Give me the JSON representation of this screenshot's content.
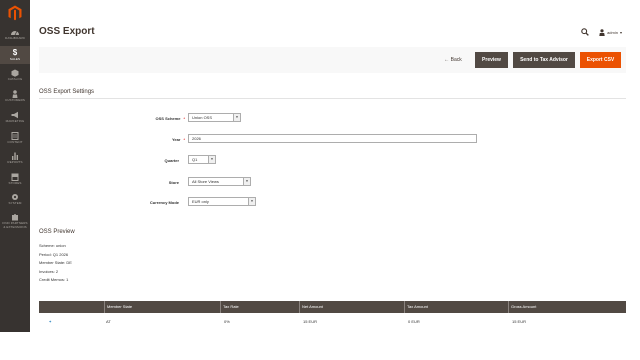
{
  "nav": {
    "items": [
      {
        "key": "dashboard",
        "label": "Dashboard",
        "icon": "speedometer-icon"
      },
      {
        "key": "sales",
        "label": "Sales",
        "icon": "dollar-icon",
        "active": true
      },
      {
        "key": "catalog",
        "label": "Catalog",
        "icon": "cube-icon"
      },
      {
        "key": "customers",
        "label": "Customers",
        "icon": "person-icon"
      },
      {
        "key": "marketing",
        "label": "Marketing",
        "icon": "megaphone-icon"
      },
      {
        "key": "content",
        "label": "Content",
        "icon": "layout-icon"
      },
      {
        "key": "reports",
        "label": "Reports",
        "icon": "bar-chart-icon"
      },
      {
        "key": "stores",
        "label": "Stores",
        "icon": "storefront-icon"
      },
      {
        "key": "system",
        "label": "System",
        "icon": "gear-icon"
      },
      {
        "key": "partners",
        "label": "Find Partners & Extensions",
        "icon": "puzzle-icon"
      }
    ]
  },
  "header": {
    "title": "OSS Export",
    "user": "admin"
  },
  "actions": {
    "back": "Back",
    "preview": "Preview",
    "advisor": "Send to Tax Advisor",
    "export": "Export CSV"
  },
  "settings": {
    "title": "OSS Export Settings",
    "scheme": {
      "label": "OSS Scheme",
      "value": "Union OSS",
      "required": true
    },
    "year": {
      "label": "Year",
      "value": "2026",
      "required": true
    },
    "quarter": {
      "label": "Quarter",
      "value": "Q1"
    },
    "store": {
      "label": "Store",
      "value": "All Store Views"
    },
    "currency": {
      "label": "Currency Mode",
      "value": "EUR only"
    }
  },
  "preview": {
    "title": "OSS Preview",
    "lines": [
      "Scheme: union",
      "Period: Q1 2026",
      "Member State: DE",
      "Invoices: 2",
      "Credit Memos: 1"
    ]
  },
  "table": {
    "columns": [
      "",
      "Member State",
      "Tax Rate",
      "Net Amount",
      "Tax Amount",
      "Gross Amount"
    ],
    "rows": [
      {
        "expand": "+",
        "member_state": "AT",
        "tax_rate": "0%",
        "net": "15 EUR",
        "tax": "0 EUR",
        "gross": "15 EUR"
      }
    ]
  },
  "colors": {
    "sidebar": "#373330",
    "button_dark": "#514943",
    "accent": "#eb5202"
  }
}
